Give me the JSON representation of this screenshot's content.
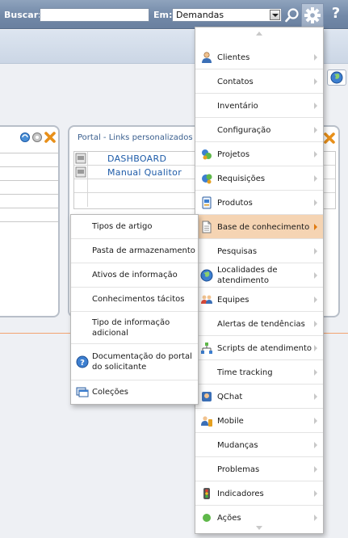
{
  "topbar": {
    "search_label": "Buscar:",
    "search_value": "",
    "scope_label": "Em:",
    "scope_value": "Demandas",
    "help_label": "?"
  },
  "portal_panel": {
    "title": "Portal - Links personalizados",
    "links": [
      "DASHBOARD",
      "Manual Qualitor"
    ]
  },
  "menu": {
    "items": [
      {
        "label": "Clientes",
        "icon": "user-icon"
      },
      {
        "label": "Contatos",
        "icon": ""
      },
      {
        "label": "Inventário",
        "icon": ""
      },
      {
        "label": "Configuração",
        "icon": ""
      },
      {
        "label": "Projetos",
        "icon": "projects-icon"
      },
      {
        "label": "Requisições",
        "icon": "requests-icon"
      },
      {
        "label": "Produtos",
        "icon": "products-icon"
      },
      {
        "label": "Base de conhecimento",
        "icon": "document-icon",
        "active": true
      },
      {
        "label": "Pesquisas",
        "icon": ""
      },
      {
        "label": "Localidades de atendimento",
        "icon": "globe-icon"
      },
      {
        "label": "Equipes",
        "icon": "team-icon"
      },
      {
        "label": "Alertas de tendências",
        "icon": ""
      },
      {
        "label": "Scripts de atendimento",
        "icon": "workflow-icon"
      },
      {
        "label": "Time tracking",
        "icon": ""
      },
      {
        "label": "QChat",
        "icon": "chat-icon"
      },
      {
        "label": "Mobile",
        "icon": "mobile-icon"
      },
      {
        "label": "Mudanças",
        "icon": ""
      },
      {
        "label": "Problemas",
        "icon": ""
      },
      {
        "label": "Indicadores",
        "icon": "indicators-icon"
      },
      {
        "label": "Ações",
        "icon": ""
      }
    ]
  },
  "submenu": {
    "items": [
      {
        "label": "Tipos de artigo",
        "icon": ""
      },
      {
        "label": "Pasta de armazenamento",
        "icon": ""
      },
      {
        "label": "Ativos de informação",
        "icon": ""
      },
      {
        "label": "Conhecimentos tácitos",
        "icon": ""
      },
      {
        "label": "Tipo de informação adicional",
        "icon": ""
      },
      {
        "label": "Documentação do portal do solicitante",
        "icon": "help-icon"
      },
      {
        "label": "Coleções",
        "icon": "collections-icon"
      }
    ]
  },
  "colors": {
    "topbar": "#7289a8",
    "active_item": "#f5d4b3",
    "link": "#1d5ba8",
    "accent_line": "#f2a36f"
  }
}
